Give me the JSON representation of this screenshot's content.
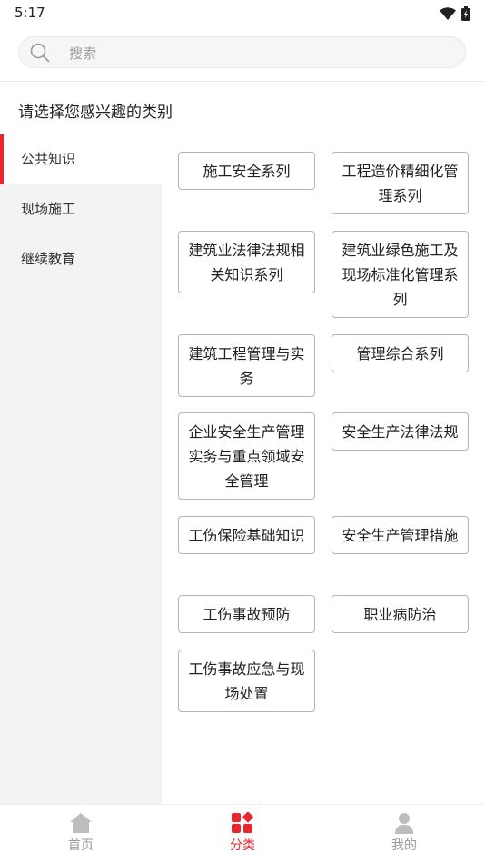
{
  "status": {
    "time": "5:17"
  },
  "search": {
    "placeholder": "搜索"
  },
  "heading": "请选择您感兴趣的类别",
  "sidebar": {
    "items": [
      {
        "label": "公共知识",
        "active": true
      },
      {
        "label": "现场施工",
        "active": false
      },
      {
        "label": "继续教育",
        "active": false
      }
    ]
  },
  "categories": [
    "施工安全系列",
    "工程造价精细化管理系列",
    "建筑业法律法规相关知识系列",
    "建筑业绿色施工及现场标准化管理系列",
    "建筑工程管理与实务",
    "管理综合系列",
    "企业安全生产管理实务与重点领域安全管理",
    "安全生产法律法规",
    "工伤保险基础知识",
    "安全生产管理措施",
    "工伤事故预防",
    "职业病防治",
    "工伤事故应急与现场处置"
  ],
  "tabbar": {
    "items": [
      {
        "label": "首页",
        "icon": "home-icon",
        "active": false
      },
      {
        "label": "分类",
        "icon": "category-icon",
        "active": true
      },
      {
        "label": "我的",
        "icon": "user-icon",
        "active": false
      }
    ]
  },
  "colors": {
    "accent": "#e8262d",
    "sidebar_bg": "#f2f3f3",
    "inactive": "#9a9a9a"
  }
}
